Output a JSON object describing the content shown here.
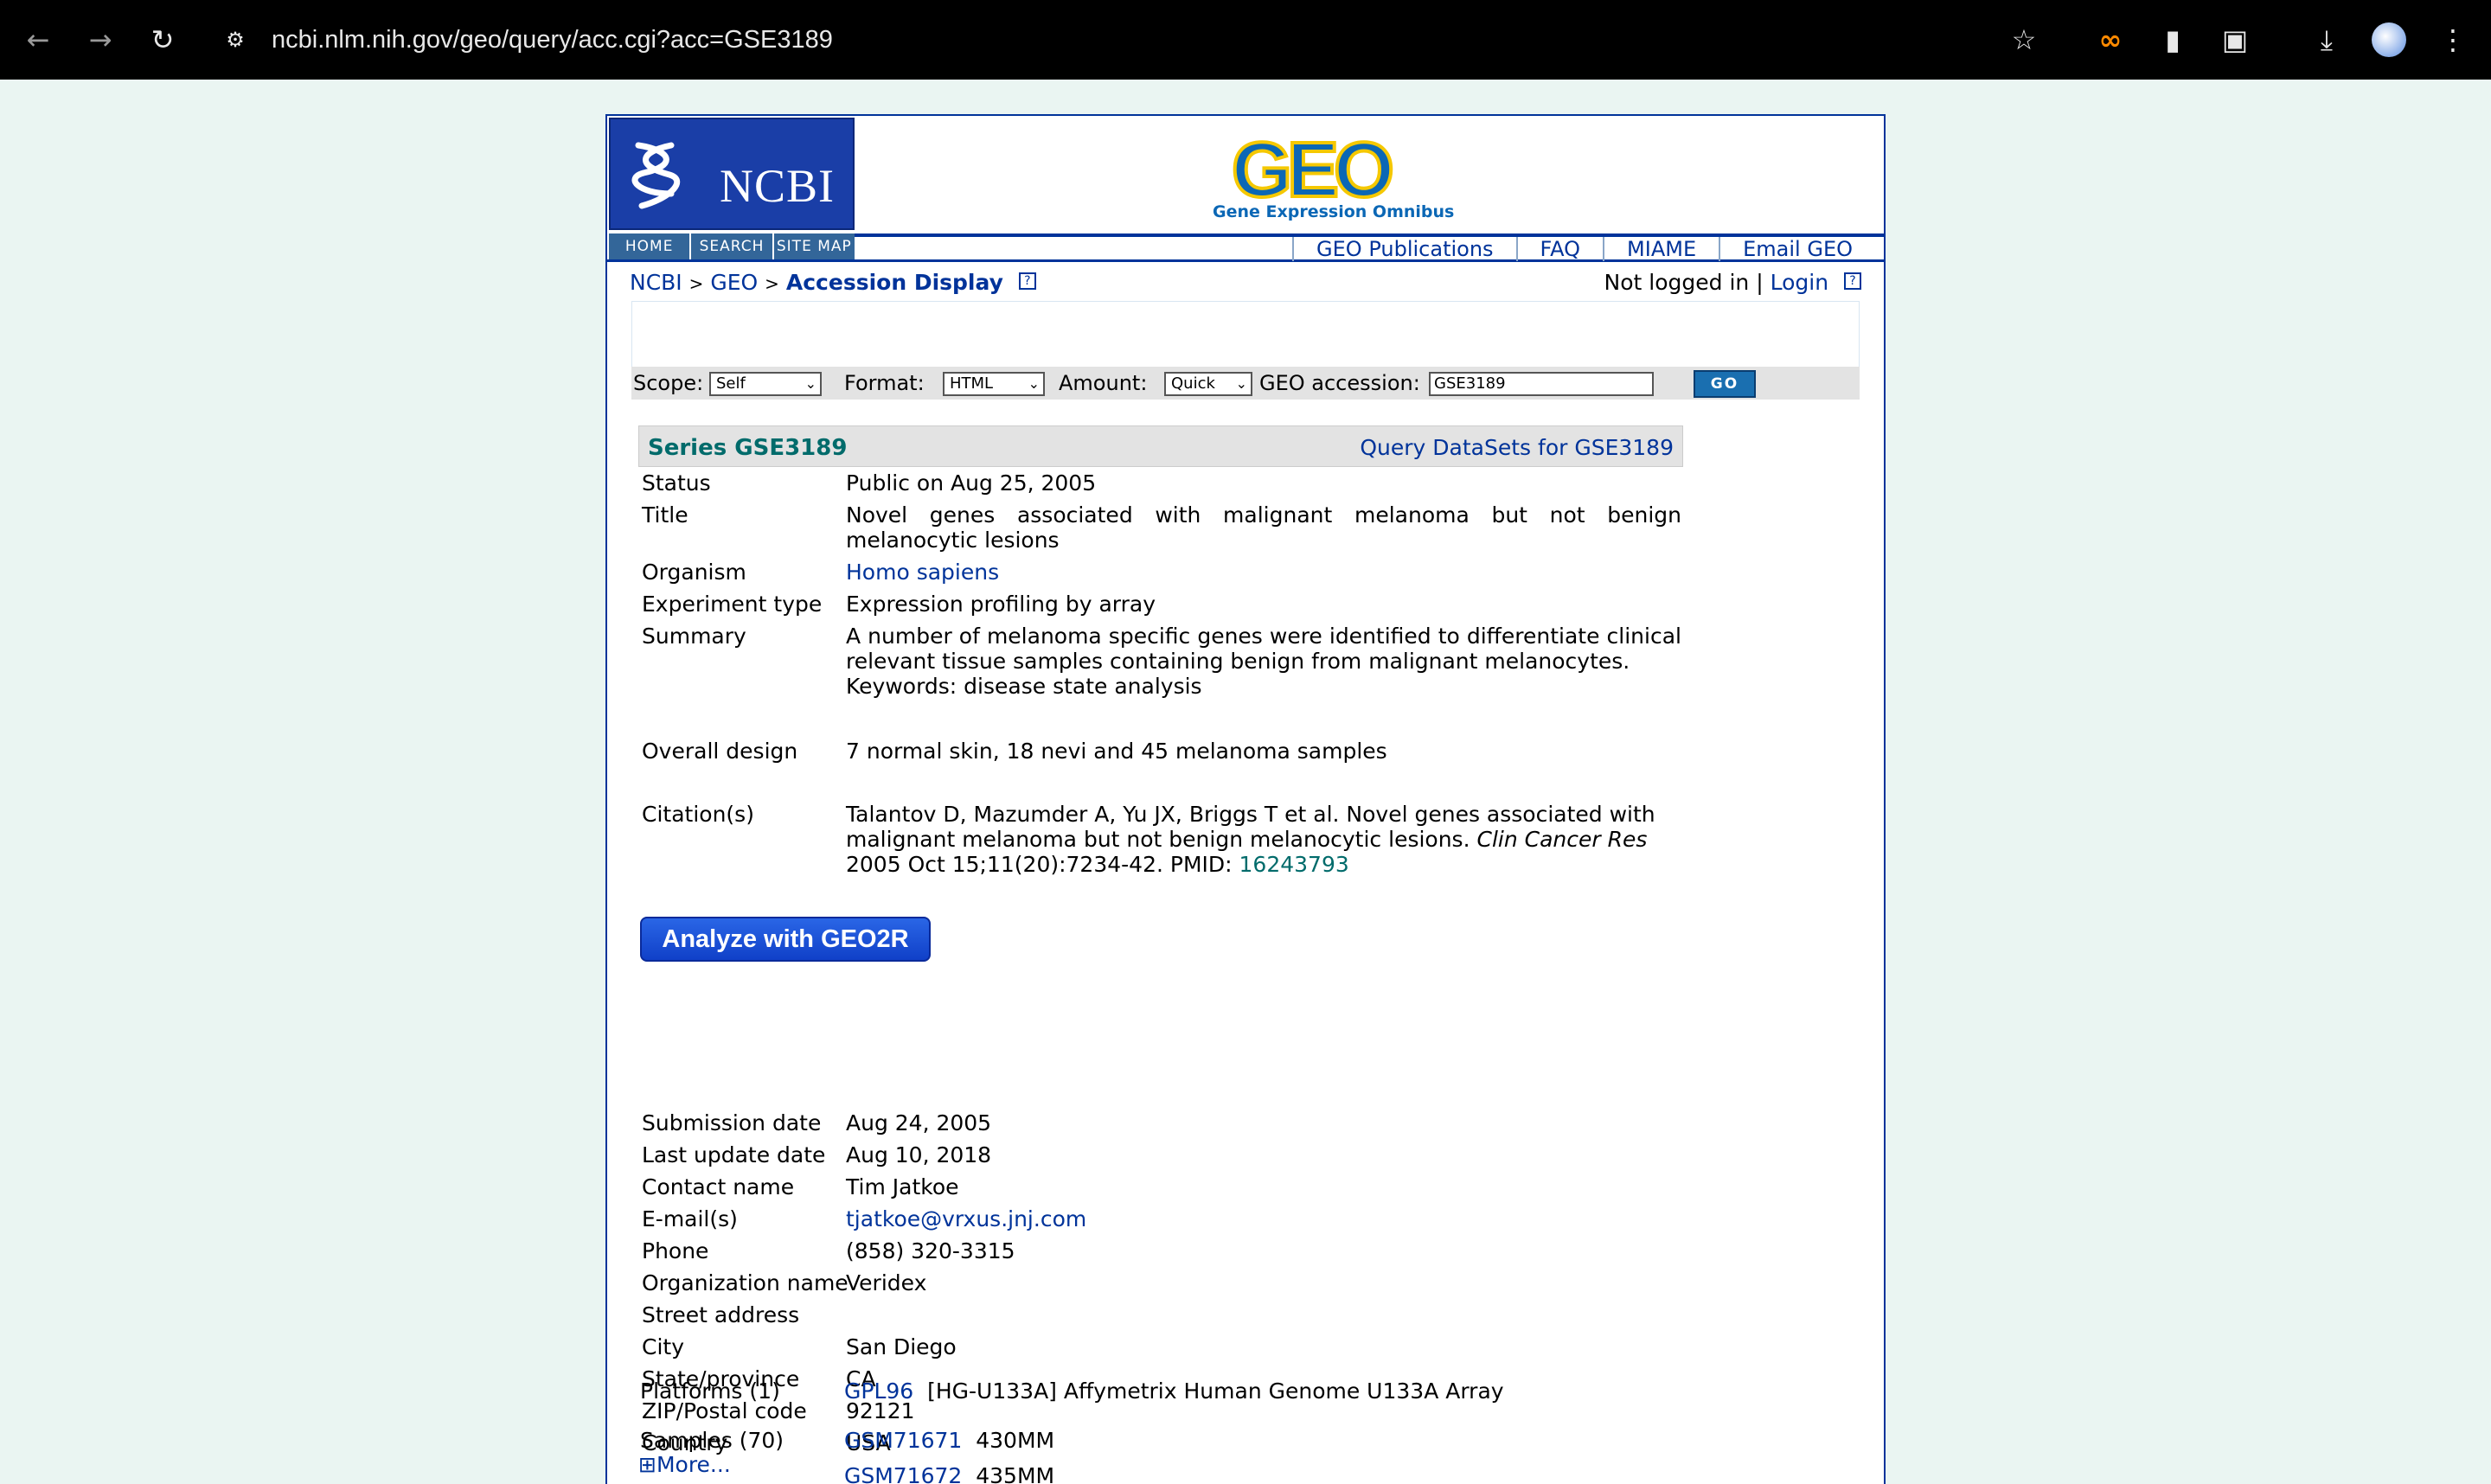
{
  "browser": {
    "url": "ncbi.nlm.nih.gov/geo/query/acc.cgi?acc=GSE3189"
  },
  "ncbi": {
    "logo_text": "NCBI",
    "nav": [
      "HOME",
      "SEARCH",
      "SITE MAP"
    ]
  },
  "geo": {
    "logo_text": "GEO",
    "logo_sub": "Gene Expression Omnibus",
    "links": [
      "GEO Publications",
      "FAQ",
      "MIAME",
      "Email GEO"
    ]
  },
  "breadcrumb": {
    "ncbi": "NCBI",
    "sep": ">",
    "geo": "GEO",
    "current": "Accession Display",
    "help": "?"
  },
  "login": {
    "status": "Not logged in",
    "sep": "|",
    "link": "Login",
    "help": "?"
  },
  "search": {
    "scope_label": "Scope:",
    "scope_value": "Self",
    "format_label": "Format:",
    "format_value": "HTML",
    "amount_label": "Amount:",
    "amount_value": "Quick",
    "accession_label": "GEO accession:",
    "accession_value": "GSE3189",
    "go": "GO"
  },
  "series": {
    "title": "Series GSE3189",
    "query_link": "Query DataSets for GSE3189"
  },
  "fields": {
    "status_label": "Status",
    "status": "Public on Aug 25, 2005",
    "title_label": "Title",
    "title": "Novel genes associated with malignant melanoma but not benign melanocytic lesions",
    "organism_label": "Organism",
    "organism": "Homo sapiens",
    "exp_label": "Experiment type",
    "exp": "Expression profiling by array",
    "summary_label": "Summary",
    "summary_1": "A number of melanoma specific genes were identified to differentiate clinical relevant tissue samples containing benign from malignant melanocytes.",
    "summary_2": "Keywords: disease state analysis",
    "design_label": "Overall design",
    "design": "7 normal skin, 18 nevi and 45 melanoma samples",
    "citation_label": "Citation(s)",
    "citation_pre": "Talantov D, Mazumder A, Yu JX, Briggs T et al. Novel genes associated with malignant melanoma but not benign melanocytic lesions.",
    "citation_journal": "Clin Cancer Res",
    "citation_post": "2005 Oct 15;11(20):7234-42. PMID:",
    "pmid": "16243793",
    "geo2r": "Analyze with GEO2R",
    "submission_label": "Submission date",
    "submission": "Aug 24, 2005",
    "update_label": "Last update date",
    "update": "Aug 10, 2018",
    "contact_label": "Contact name",
    "contact": "Tim Jatkoe",
    "email_label": "E-mail(s)",
    "email": "tjatkoe@vrxus.jnj.com",
    "phone_label": "Phone",
    "phone": "(858) 320-3315",
    "org_label": "Organization name",
    "org": "Veridex",
    "street_label": "Street address",
    "city_label": "City",
    "city": "San Diego",
    "state_label": "State/province",
    "state": "CA",
    "zip_label": "ZIP/Postal code",
    "zip": "92121",
    "country_label": "Country",
    "country": "USA",
    "platforms_label": "Platforms (1)",
    "platform_id": "GPL96",
    "platform_desc": "[HG-U133A] Affymetrix Human Genome U133A Array",
    "samples_label": "Samples (70)",
    "more": "More...",
    "sample1_id": "GSM71671",
    "sample1_desc": "430MM",
    "sample2_id": "GSM71672",
    "sample2_desc": "435MM"
  }
}
